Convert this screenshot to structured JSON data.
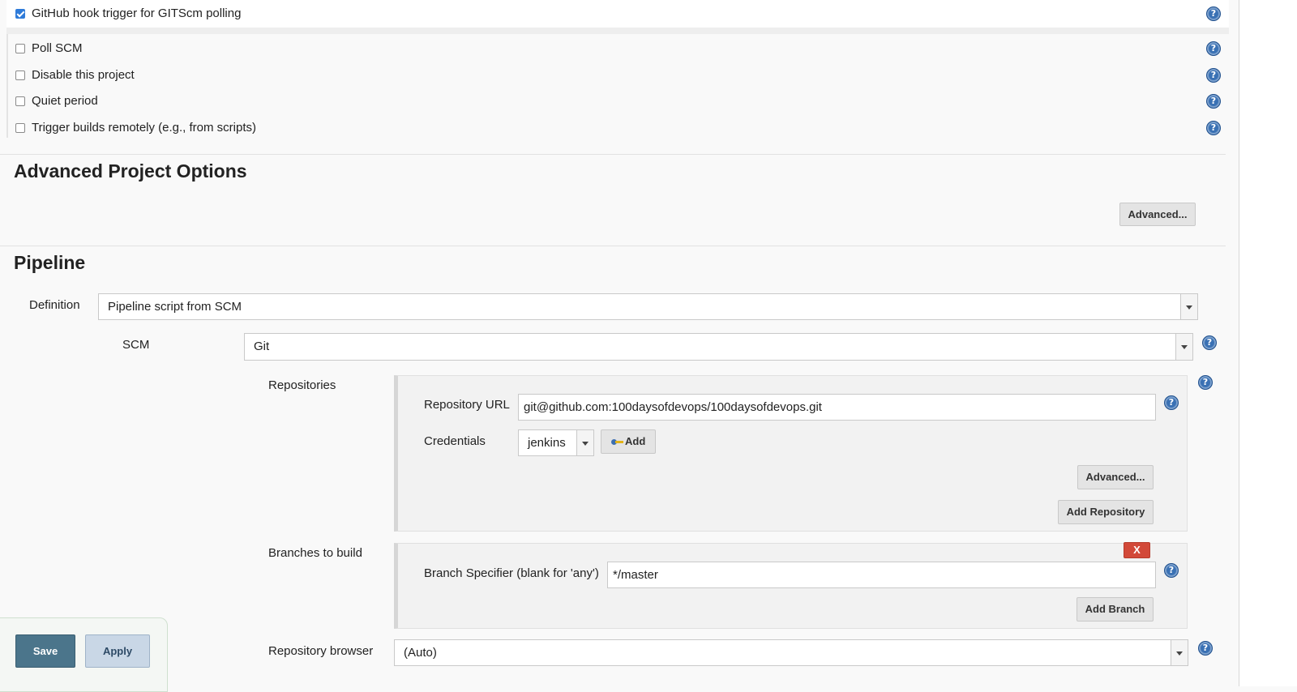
{
  "triggers": [
    {
      "label": "GitHub hook trigger for GITScm polling",
      "checked": true
    },
    {
      "label": "Poll SCM",
      "checked": false
    },
    {
      "label": "Disable this project",
      "checked": false
    },
    {
      "label": "Quiet period",
      "checked": false
    },
    {
      "label": "Trigger builds remotely (e.g., from scripts)",
      "checked": false
    }
  ],
  "help_glyph": "?",
  "advanced_options": {
    "title": "Advanced Project Options",
    "advanced_button": "Advanced..."
  },
  "pipeline": {
    "title": "Pipeline",
    "definition_label": "Definition",
    "definition_value": "Pipeline script from SCM",
    "scm_label": "SCM",
    "scm_value": "Git",
    "repositories_label": "Repositories",
    "repository_url_label": "Repository URL",
    "repository_url_value": "git@github.com:100daysofdevops/100daysofdevops.git",
    "credentials_label": "Credentials",
    "credentials_value": "jenkins",
    "add_credentials_button": "Add",
    "repo_advanced_button": "Advanced...",
    "add_repository_button": "Add Repository",
    "branches_label": "Branches to build",
    "delete_branch_button": "X",
    "branch_specifier_label": "Branch Specifier (blank for 'any')",
    "branch_specifier_value": "*/master",
    "add_branch_button": "Add Branch",
    "repo_browser_label": "Repository browser",
    "repo_browser_value": "(Auto)"
  },
  "footer": {
    "save_button": "Save",
    "apply_button": "Apply"
  },
  "colors": {
    "help_icon": "#3a71b4",
    "checkbox_checked": "#2f7bd9",
    "save_button": "#4b758b",
    "apply_button": "#c9d7e6",
    "delete_button": "#d24939"
  }
}
